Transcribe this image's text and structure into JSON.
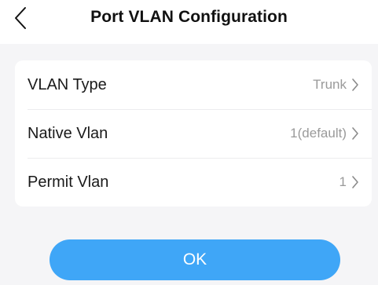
{
  "header": {
    "title": "Port VLAN Configuration",
    "back_icon": "chevron-left-icon"
  },
  "settings": {
    "rows": [
      {
        "label": "VLAN Type",
        "value": "Trunk"
      },
      {
        "label": "Native Vlan",
        "value": "1(default)"
      },
      {
        "label": "Permit Vlan",
        "value": "1"
      }
    ]
  },
  "actions": {
    "ok_label": "OK"
  },
  "colors": {
    "background": "#f5f5f7",
    "card": "#ffffff",
    "accent": "#3fa6f7",
    "value_text": "#9a9a9a"
  }
}
